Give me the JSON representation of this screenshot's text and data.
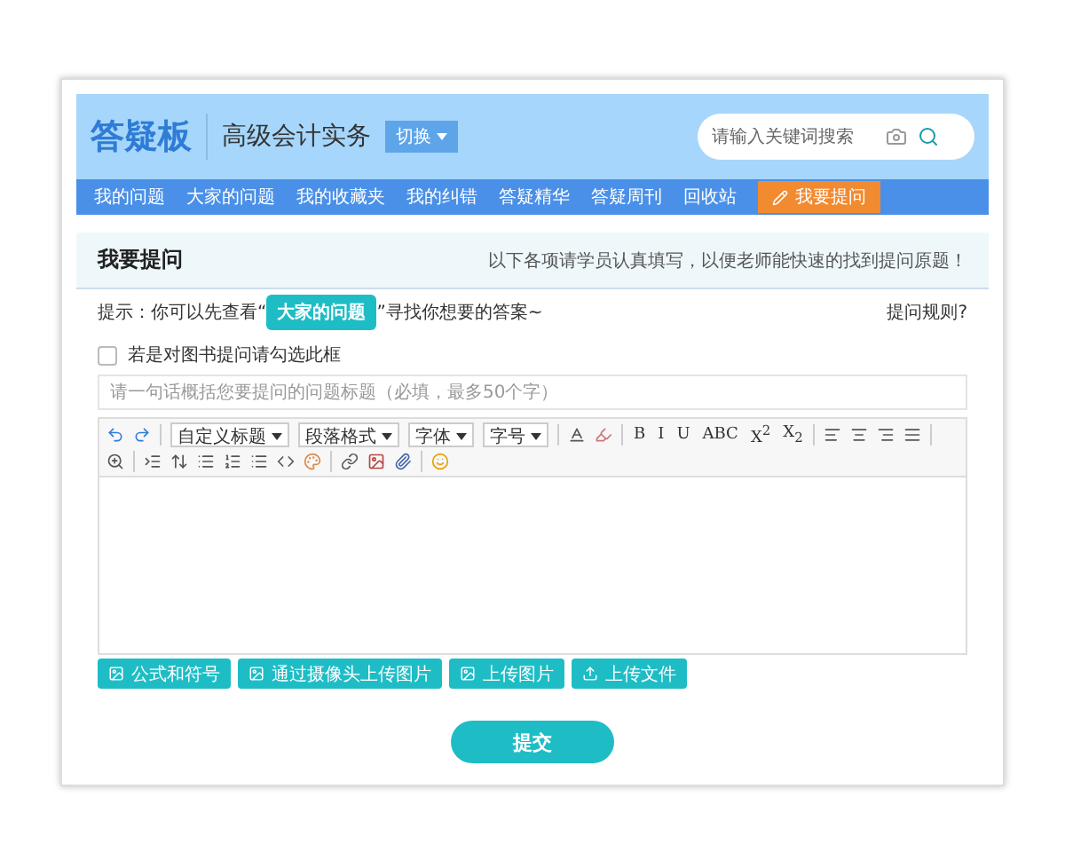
{
  "header": {
    "logo": "答疑板",
    "course": "高级会计实务",
    "switch": "切换",
    "search": {
      "placeholder": "请输入关键词搜索"
    }
  },
  "nav": [
    {
      "label": "我的问题",
      "kind": "link"
    },
    {
      "label": "大家的问题",
      "kind": "link"
    },
    {
      "label": "我的收藏夹",
      "kind": "link"
    },
    {
      "label": "我的纠错",
      "kind": "link"
    },
    {
      "label": "答疑精华",
      "kind": "link"
    },
    {
      "label": "答疑周刊",
      "kind": "link"
    },
    {
      "label": "回收站",
      "kind": "link"
    },
    {
      "label": "我要提问",
      "kind": "action"
    }
  ],
  "section": {
    "title": "我要提问",
    "note": "以下各项请学员认真填写，以便老师能快速的找到提问原题！"
  },
  "hint": {
    "prefix": "提示：你可以先查看“",
    "link": "大家的问题",
    "suffix": "”寻找你想要的答案~",
    "rules": "提问规则?"
  },
  "book_checkbox": {
    "label": "若是对图书提问请勾选此框",
    "checked": false
  },
  "title_field": {
    "placeholder": "请一句话概括您要提问的问题标题（必填，最多50个字）"
  },
  "toolbar": {
    "dropdowns": [
      "自定义标题",
      "段落格式",
      "字体",
      "字号"
    ],
    "letters": [
      "B",
      "I",
      "U",
      "ABC",
      "X$^{2}$",
      "X$_{2}$"
    ]
  },
  "upload_buttons": [
    "公式和符号",
    "通过摄像头上传图片",
    "上传图片",
    "上传文件"
  ],
  "submit": "提交"
}
